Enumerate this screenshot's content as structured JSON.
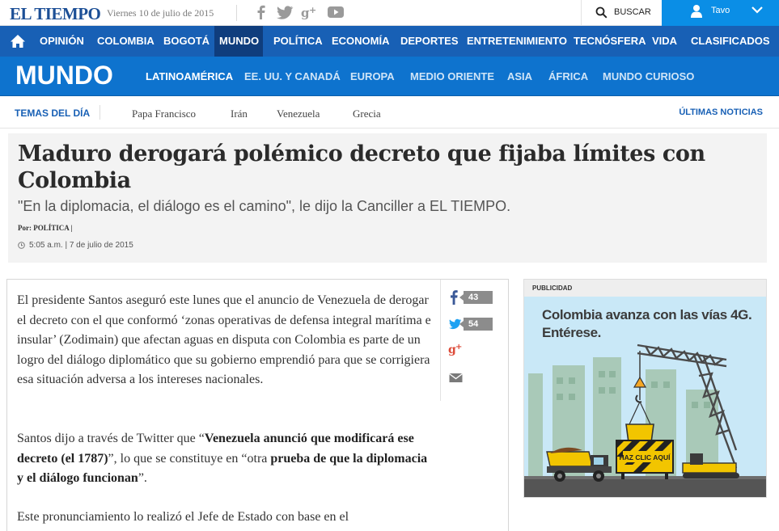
{
  "topbar": {
    "logo": "EL TIEMPO",
    "date": "Viernes 10 de julio de 2015",
    "search_label": "BUSCAR",
    "user_name": "Tavo",
    "social_icons": [
      "facebook-icon",
      "twitter-icon",
      "google-plus-icon",
      "youtube-icon"
    ]
  },
  "main_nav": {
    "items": [
      "OPINIÓN",
      "COLOMBIA",
      "BOGOTÁ",
      "MUNDO",
      "POLÍTICA",
      "ECONOMÍA",
      "DEPORTES",
      "ENTRETENIMIENTO",
      "TECNÓSFERA",
      "VIDA",
      "CLASIFICADOS"
    ],
    "active": "MUNDO"
  },
  "section_nav": {
    "title": "MUNDO",
    "items": [
      "LATINOAMÉRICA",
      "EE. UU. Y CANADÁ",
      "EUROPA",
      "MEDIO ORIENTE",
      "ASIA",
      "ÁFRICA",
      "MUNDO CURIOSO"
    ],
    "active": "LATINOAMÉRICA"
  },
  "trending": {
    "label": "TEMAS DEL DÍA",
    "topics": [
      "Papa Francisco",
      "Irán",
      "Venezuela",
      "Grecia"
    ],
    "latest_link": "ÚLTIMAS NOTICIAS"
  },
  "article": {
    "headline": "Maduro derogará polémico decreto que fijaba límites con Colombia",
    "subtitle": "\"En la diplomacia, el diálogo es el camino\", le dijo la Canciller a EL TIEMPO.",
    "byline_prefix": "Por:",
    "byline_section": "POLÍTICA |",
    "time": "5:05 a.m. | 7 de julio de 2015",
    "p1": "El presidente Santos aseguró este lunes que el anuncio de Venezuela de derogar el decreto con el que conformó ‘zonas operativas de defensa integral marítima e insular’ (Zodimain) que afectan aguas en disputa con Colombia es parte de un logro del diálogo diplomático que su gobierno emprendió para que se corrigiera esa situación adversa a los intereses nacionales.",
    "p2_a": "Santos dijo a través de Twitter que “",
    "p2_b": "Venezuela anunció que modificará ese decreto (el 1787)",
    "p2_c": "”, lo que se constituye en “otra ",
    "p2_d": "prueba de que la diplomacia y el diálogo funcionan",
    "p2_e": "”.",
    "p3": "Este pronunciamiento lo realizó el Jefe de Estado con base en el"
  },
  "share": {
    "facebook_count": "43",
    "twitter_count": "54"
  },
  "ad": {
    "label": "PUBLICIDAD",
    "headline": "Colombia avanza con las vías 4G. Entérese.",
    "sign": "HAZ CLIC AQUÍ"
  },
  "colors": {
    "brand_blue": "#1860b5",
    "section_blue": "#0e73ce",
    "user_blue": "#0a8ee6",
    "ad_sky": "#c9e8f7"
  }
}
